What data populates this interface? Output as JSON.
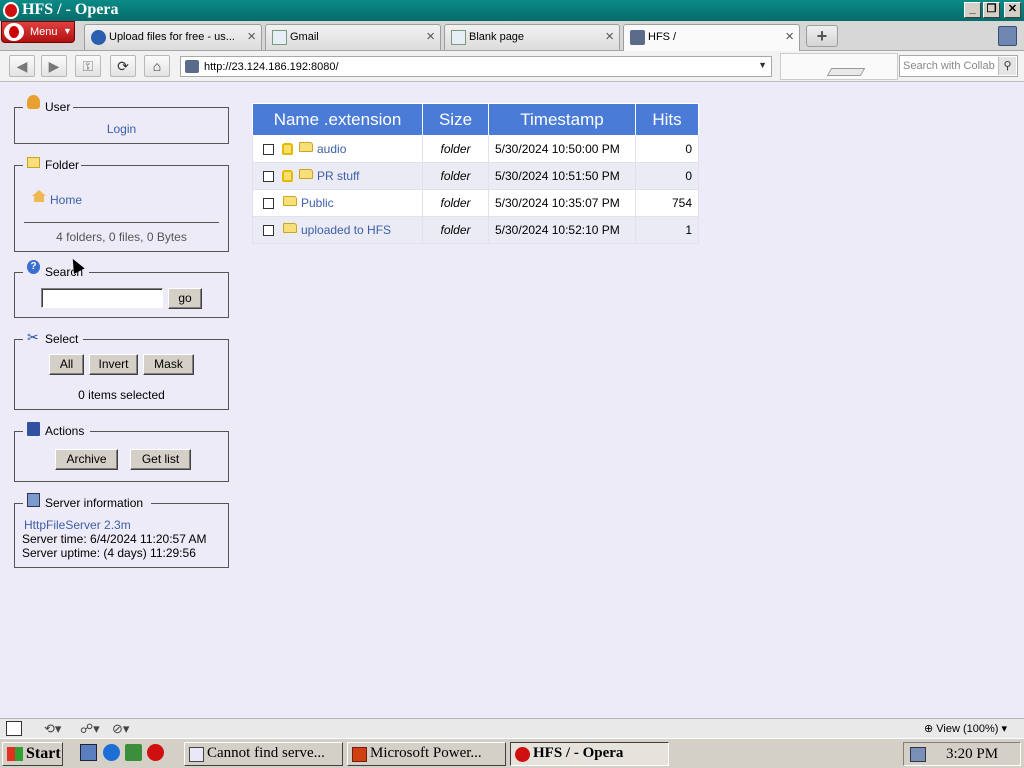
{
  "window": {
    "title": "HFS / - Opera"
  },
  "tabs": {
    "menu_label": "Menu",
    "items": [
      {
        "label": "Upload files for free - us..."
      },
      {
        "label": "Gmail"
      },
      {
        "label": "Blank page"
      },
      {
        "label": "HFS /"
      }
    ]
  },
  "nav": {
    "url": "http://23.124.186.192:8080/",
    "search_placeholder": "Search with Collab"
  },
  "panels": {
    "user": {
      "title": "User",
      "login": "Login"
    },
    "folder": {
      "title": "Folder",
      "home": "Home",
      "summary": "4 folders, 0 files, 0 Bytes"
    },
    "search": {
      "title": "Search",
      "go": "go",
      "value": ""
    },
    "select": {
      "title": "Select",
      "all": "All",
      "invert": "Invert",
      "mask": "Mask",
      "status": "0 items selected"
    },
    "actions": {
      "title": "Actions",
      "archive": "Archive",
      "get_list": "Get list"
    },
    "server": {
      "title": "Server information",
      "link": "HttpFileServer 2.3m",
      "time": "Server time: 6/4/2024 11:20:57 AM",
      "uptime": "Server uptime: (4 days) 11:29:56"
    }
  },
  "table": {
    "headers": {
      "name": "Name .extension",
      "size": "Size",
      "timestamp": "Timestamp",
      "hits": "Hits"
    },
    "rows": [
      {
        "name": "audio",
        "size": "folder",
        "timestamp": "5/30/2024 10:50:00 PM",
        "hits": "0",
        "locked": true
      },
      {
        "name": "PR stuff",
        "size": "folder",
        "timestamp": "5/30/2024 10:51:50 PM",
        "hits": "0",
        "locked": true
      },
      {
        "name": "Public",
        "size": "folder",
        "timestamp": "5/30/2024 10:35:07 PM",
        "hits": "754",
        "locked": false
      },
      {
        "name": "uploaded to HFS",
        "size": "folder",
        "timestamp": "5/30/2024 10:52:10 PM",
        "hits": "1",
        "locked": false
      }
    ]
  },
  "statusbar": {
    "zoom": "View (100%)"
  },
  "taskbar": {
    "start": "Start",
    "tasks": [
      {
        "label": "Cannot find serve..."
      },
      {
        "label": "Microsoft Power..."
      },
      {
        "label": "HFS / - Opera"
      }
    ],
    "clock": "3:20 PM"
  },
  "colors": {
    "table_header": "#4a7bd6",
    "page_bg": "#ecebf7",
    "titlebar": "#0a8a86",
    "link": "#3d5fa8"
  }
}
